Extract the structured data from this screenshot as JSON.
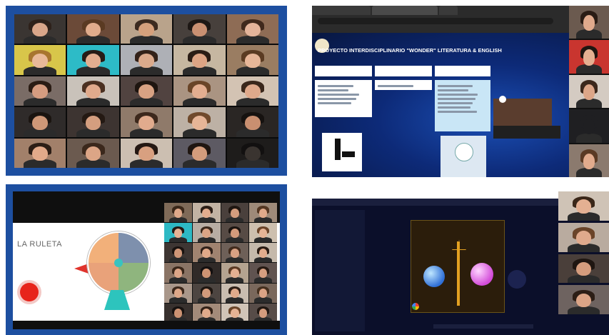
{
  "panels": {
    "video_grid": {
      "tiles": [
        {
          "bg": "#3a3532",
          "skin": "#d9a68a",
          "hair": "#2e211a"
        },
        {
          "bg": "#6b4a38",
          "skin": "#e0ac8c",
          "hair": "#5a3a22"
        },
        {
          "bg": "#b9a38b",
          "skin": "#d5a07c",
          "hair": "#3b2a1f"
        },
        {
          "bg": "#47403c",
          "skin": "#c99072",
          "hair": "#1d1714"
        },
        {
          "bg": "#8e6c55",
          "skin": "#e4b49a",
          "hair": "#40291c"
        },
        {
          "bg": "#d8c64a",
          "skin": "#e9b999",
          "hair": "#a8752f"
        },
        {
          "bg": "#2dbbc7",
          "skin": "#e2ad8f",
          "hair": "#261b16"
        },
        {
          "bg": "#aeb0b6",
          "skin": "#dbaa8c",
          "hair": "#332219"
        },
        {
          "bg": "#c6b7a1",
          "skin": "#dda484",
          "hair": "#2b1d15"
        },
        {
          "bg": "#9a7d62",
          "skin": "#e7b698",
          "hair": "#5b3b22"
        },
        {
          "bg": "#7a6c66",
          "skin": "#d59c80",
          "hair": "#2a1c14"
        },
        {
          "bg": "#c9c2ba",
          "skin": "#e0aa8c",
          "hair": "#4a3021"
        },
        {
          "bg": "#514340",
          "skin": "#d8a283",
          "hair": "#1e1510"
        },
        {
          "bg": "#aa9482",
          "skin": "#e3ae90",
          "hair": "#6a4528"
        },
        {
          "bg": "#d3c3b3",
          "skin": "#dfa98b",
          "hair": "#3a271b"
        },
        {
          "bg": "#2f2b2a",
          "skin": "#cf9878",
          "hair": "#1a1410"
        },
        {
          "bg": "#3d3431",
          "skin": "#d49e7f",
          "hair": "#241913"
        },
        {
          "bg": "#8f7a6a",
          "skin": "#e1ab8d",
          "hair": "#3c281c"
        },
        {
          "bg": "#bdb1a5",
          "skin": "#e6b597",
          "hair": "#704a2c"
        },
        {
          "bg": "#2a2624",
          "skin": "#c98f70",
          "hair": "#161210"
        },
        {
          "bg": "#a2806a",
          "skin": "#e2aa8a",
          "hair": "#2c1e16"
        },
        {
          "bg": "#6b5a4f",
          "skin": "#dca586",
          "hair": "#3b281c"
        },
        {
          "bg": "#ccbfb1",
          "skin": "#d8a080",
          "hair": "#241812"
        },
        {
          "bg": "#5d5a63",
          "skin": "#d39c7c",
          "hair": "#1f1611"
        },
        {
          "bg": "#1e1c1b",
          "skin": "#3a3430",
          "hair": "#121010"
        }
      ]
    },
    "ruleta": {
      "title": "LA RULETA",
      "tiles": [
        {
          "bg": "#7f6a58",
          "skin": "#dfa98a",
          "hair": "#3a2719"
        },
        {
          "bg": "#c2b3a3",
          "skin": "#e3ad8e",
          "hair": "#2c1e16"
        },
        {
          "bg": "#4a403c",
          "skin": "#d49d7e",
          "hair": "#1f1611"
        },
        {
          "bg": "#9e8a79",
          "skin": "#e0aa8b",
          "hair": "#543722"
        },
        {
          "bg": "#2db9c4",
          "skin": "#e5b294",
          "hair": "#231914"
        },
        {
          "bg": "#b8ada3",
          "skin": "#dba485",
          "hair": "#3b281b"
        },
        {
          "bg": "#574b45",
          "skin": "#d39a7b",
          "hair": "#1b1410"
        },
        {
          "bg": "#cdbfae",
          "skin": "#e6b496",
          "hair": "#6a4429"
        },
        {
          "bg": "#3e3633",
          "skin": "#cf9677",
          "hair": "#1a1310"
        },
        {
          "bg": "#a08370",
          "skin": "#e0a989",
          "hair": "#30211a"
        },
        {
          "bg": "#6e6058",
          "skin": "#d8a183",
          "hair": "#422b1d"
        },
        {
          "bg": "#c5b9ab",
          "skin": "#e2ac8d",
          "hair": "#2a1c14"
        },
        {
          "bg": "#8a7465",
          "skin": "#dca587",
          "hair": "#3a271a"
        },
        {
          "bg": "#302a28",
          "skin": "#cd9373",
          "hair": "#141010"
        },
        {
          "bg": "#b4a390",
          "skin": "#e4b092",
          "hair": "#5b3a24"
        },
        {
          "bg": "#605350",
          "skin": "#d59e80",
          "hair": "#261a13"
        },
        {
          "bg": "#a9978a",
          "skin": "#dea889",
          "hair": "#3d291c"
        },
        {
          "bg": "#4d4541",
          "skin": "#d29a7b",
          "hair": "#1e1611"
        },
        {
          "bg": "#c9bdb0",
          "skin": "#e1ab8c",
          "hair": "#2f2017"
        },
        {
          "bg": "#7a685c",
          "skin": "#daa385",
          "hair": "#45301f"
        },
        {
          "bg": "#38312e",
          "skin": "#cc9272",
          "hair": "#171210"
        },
        {
          "bg": "#a38b7a",
          "skin": "#dfaa8b",
          "hair": "#332218"
        },
        {
          "bg": "#d0c4b7",
          "skin": "#e5b395",
          "hair": "#6b462a"
        },
        {
          "bg": "#574c48",
          "skin": "#d49c7d",
          "hair": "#201712"
        }
      ]
    },
    "padlet": {
      "tabs": [
        "",
        "",
        ""
      ],
      "board_title": "PROYECTO INTERDISCIPLINARIO \"WONDER\" LITERATURA & ENGLISH",
      "columns": [
        "",
        "",
        ""
      ],
      "side_tiles": [
        {
          "bg": "#6b5a4f",
          "skin": "#e0aa8c",
          "hair": "#2a1c14"
        },
        {
          "bg": "#c9352f",
          "skin": "#e4b092",
          "hair": "#1f1611"
        },
        {
          "bg": "#d4cbc2",
          "skin": "#dda688",
          "hair": "#3c281c"
        },
        {
          "bg": "#1f1f22",
          "skin": "#1f1f22",
          "hair": "#1f1f22"
        },
        {
          "bg": "#8b7a6e",
          "skin": "#e1ab8d",
          "hair": "#5a3a24"
        }
      ]
    },
    "genially": {
      "side_tiles": [
        {
          "bg": "#cfc3b6",
          "skin": "#e4b092",
          "hair": "#3a2719"
        },
        {
          "bg": "#b9ab9f",
          "skin": "#e0aa8c",
          "hair": "#6a4429"
        },
        {
          "bg": "#4a3f3a",
          "skin": "#d49c7d",
          "hair": "#1f1611"
        },
        {
          "bg": "#6e6360",
          "skin": "#dba486",
          "hair": "#2c1e16"
        }
      ]
    }
  },
  "colors": {
    "frame_blue": "#1d4fa0",
    "wheel_blue": "#7e90ad",
    "wheel_green": "#8fb57e",
    "wheel_orange": "#e9a27a",
    "record_red": "#e7241b",
    "padlet_dark": "#0a1a4a"
  }
}
